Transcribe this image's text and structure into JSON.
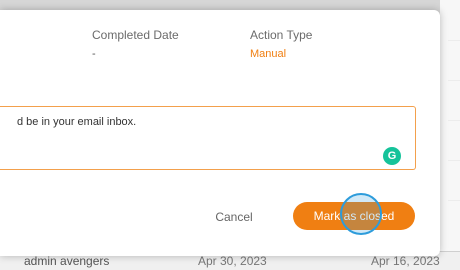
{
  "details": {
    "completed_date_label": "Completed Date",
    "completed_date_value": "-",
    "action_type_label": "Action Type",
    "action_type_value": "Manual"
  },
  "notes": {
    "text": "d be in your email inbox.",
    "assistant_icon": "grammarly-icon",
    "assistant_glyph": "G"
  },
  "actions": {
    "cancel_label": "Cancel",
    "mark_closed_label": "Mark as closed"
  },
  "background_row": {
    "name": "admin avengers",
    "date_1": "Apr 30, 2023",
    "date_2": "Apr 16, 2023"
  },
  "colors": {
    "accent": "#f07f12",
    "notes_border": "#f3a04c",
    "grammarly": "#15c39a",
    "click_indicator": "#2d9cdb"
  }
}
